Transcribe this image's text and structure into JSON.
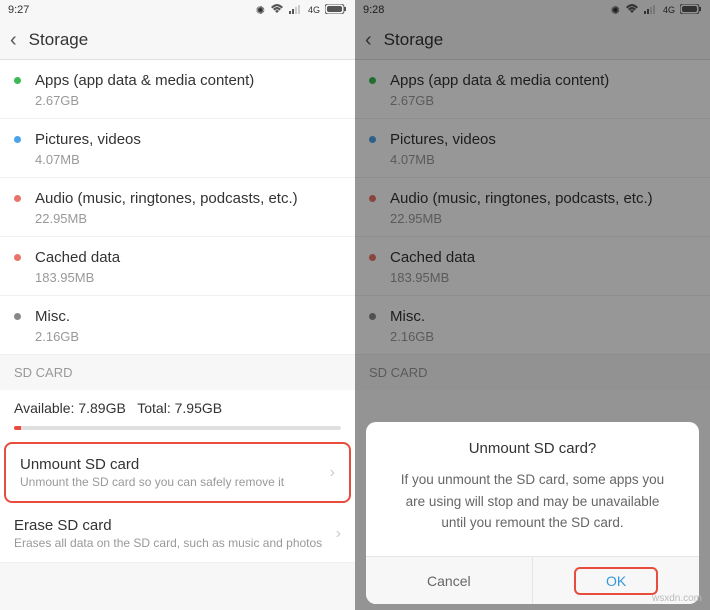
{
  "left": {
    "time": "9:27",
    "title": "Storage",
    "items": [
      {
        "dot": "#3bba54",
        "title": "Apps (app data & media content)",
        "size": "2.67GB"
      },
      {
        "dot": "#4aa3e8",
        "title": "Pictures, videos",
        "size": "4.07MB"
      },
      {
        "dot": "#e8756a",
        "title": "Audio (music, ringtones, podcasts, etc.)",
        "size": "22.95MB"
      },
      {
        "dot": "#e8756a",
        "title": "Cached data",
        "size": "183.95MB"
      },
      {
        "dot": "#888888",
        "title": "Misc.",
        "size": "2.16GB"
      }
    ],
    "section": "SD CARD",
    "available_label": "Available:",
    "available": "7.89GB",
    "total_label": "Total:",
    "total": "7.95GB",
    "unmount_title": "Unmount SD card",
    "unmount_desc": "Unmount the SD card so you can safely remove it",
    "erase_title": "Erase SD card",
    "erase_desc": "Erases all data on the SD card, such as music and photos"
  },
  "right": {
    "time": "9:28",
    "title": "Storage",
    "items": [
      {
        "dot": "#3bba54",
        "title": "Apps (app data & media content)",
        "size": "2.67GB"
      },
      {
        "dot": "#4aa3e8",
        "title": "Pictures, videos",
        "size": "4.07MB"
      },
      {
        "dot": "#e8756a",
        "title": "Audio (music, ringtones, podcasts, etc.)",
        "size": "22.95MB"
      },
      {
        "dot": "#e8756a",
        "title": "Cached data",
        "size": "183.95MB"
      },
      {
        "dot": "#888888",
        "title": "Misc.",
        "size": "2.16GB"
      }
    ],
    "section": "SD CARD",
    "dialog_title": "Unmount SD card?",
    "dialog_message": "If you unmount the SD card, some apps you are using will stop and may be unavailable until you remount the SD card.",
    "cancel": "Cancel",
    "ok": "OK"
  },
  "watermark": "wsxdn.com"
}
